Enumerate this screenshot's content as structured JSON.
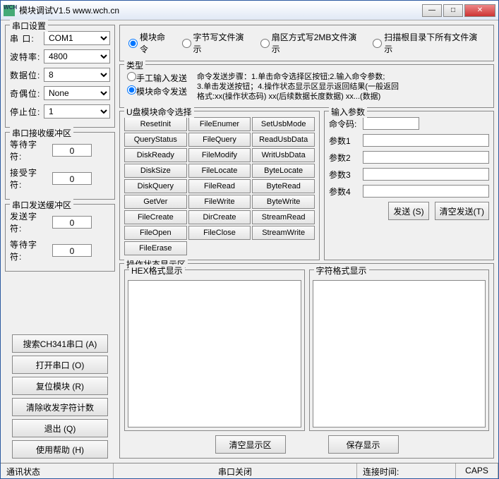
{
  "title": "模块调试V1.5      www.wch.cn",
  "serial_group": {
    "title": "串口设置",
    "port_label": "串  口:",
    "port": "COM1",
    "baud_label": "波特率:",
    "baud": "4800",
    "databits_label": "数据位:",
    "databits": "8",
    "parity_label": "奇偶位:",
    "parity": "None",
    "stopbits_label": "停止位:",
    "stopbits": "1"
  },
  "recv_group": {
    "title": "串口接收缓冲区",
    "wait_label": "等待字符:",
    "wait_count": "0",
    "recv_label": "接受字符:",
    "recv_count": "0"
  },
  "send_group": {
    "title": "串口发送缓冲区",
    "send_label": "发送字符:",
    "send_count": "0",
    "wait_label": "等待字符:",
    "wait_count": "0"
  },
  "left_buttons": {
    "search": "搜索CH341串口 (A)",
    "open": "打开串口 (O)",
    "reset": "复位模块 (R)",
    "clear": "清除收发字符计数",
    "exit": "退出 (Q)",
    "help": "使用帮助 (H)"
  },
  "mode_radios": {
    "r1": "模块命令",
    "r2": "字节写文件演示",
    "r3": "扇区方式写2MB文件演示",
    "r4": "扫描根目录下所有文件演示"
  },
  "type_group": {
    "title": "类型",
    "manual": "手工输入发送",
    "module": "模块命令发送",
    "help1": "命令发送步骤：1.单击命令选择区按钮;2.输入命令参数;",
    "help2": "3.单击发送按钮；4.操作状态显示区显示返回结果(一般返回",
    "help3": "格式:xx(操作状态码) xx(后续数据长度数据) xx...(数据)"
  },
  "cmd_group": {
    "title": "U盘模块命令选择",
    "cmds": [
      "ResetInit",
      "FileEnumer",
      "SetUsbMode",
      "QueryStatus",
      "FileQuery",
      "ReadUsbData",
      "DiskReady",
      "FileModify",
      "WritUsbData",
      "DiskSize",
      "FileLocate",
      "ByteLocate",
      "DiskQuery",
      "FileRead",
      "ByteRead",
      "GetVer",
      "FileWrite",
      "ByteWrite",
      "FileCreate",
      "DirCreate",
      "StreamRead",
      "FileOpen",
      "FileClose",
      "StreamWrite",
      "FileErase"
    ]
  },
  "param_group": {
    "title": "输入参数",
    "code_label": "命令码:",
    "p1": "参数1",
    "p2": "参数2",
    "p3": "参数3",
    "p4": "参数4",
    "send_btn": "发送 (S)",
    "clear_btn": "清空发送(T)"
  },
  "status_group": {
    "title": "操作状态显示区",
    "hex_title": "HEX格式显示",
    "char_title": "字符格式显示",
    "clear_btn": "清空显示区",
    "save_btn": "保存显示"
  },
  "statusbar": {
    "comm": "通讯状态",
    "serial": "串口关闭",
    "conn": "连接时间:",
    "caps": "CAPS"
  }
}
